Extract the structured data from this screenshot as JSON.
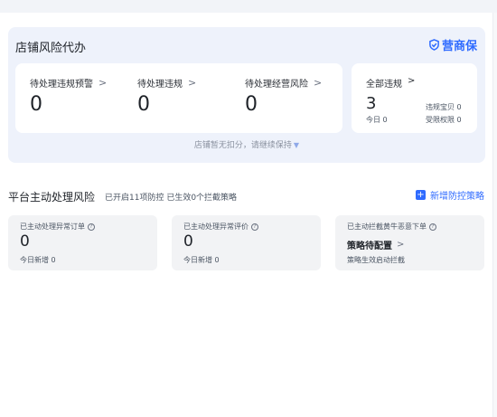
{
  "risk": {
    "title": "店铺风险代办",
    "brand": "营商保",
    "stats": [
      {
        "label": "待处理违规预警",
        "value": "0"
      },
      {
        "label": "待处理违规",
        "value": "0"
      },
      {
        "label": "待处理经营风险",
        "value": "0"
      }
    ],
    "all": {
      "label": "全部违规",
      "value": "3",
      "today": "今日 0",
      "violation_items": "违规宝贝 0",
      "restrictions": "受限权限 0"
    },
    "footer": "店铺暂无扣分，请继续保持"
  },
  "platform": {
    "title": "平台主动处理风险",
    "subtitle": "已开启11项防控 已生效0个拦截策略",
    "add_label": "新增防控策略",
    "cards": [
      {
        "label": "已主动处理异常订单",
        "value": "0",
        "sub": "今日新增 0"
      },
      {
        "label": "已主动处理异常评价",
        "value": "0",
        "sub": "今日新增 0"
      },
      {
        "label": "已主动拦截黄牛恶意下单",
        "strategy": "策略待配置",
        "sub": "策略生效启动拦截"
      }
    ]
  },
  "colors": {
    "accent": "#2f6bff",
    "card_bg": "#eef2fb"
  }
}
